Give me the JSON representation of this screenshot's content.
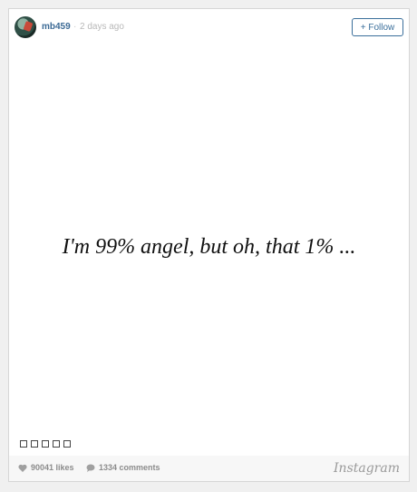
{
  "post": {
    "username": "mb459",
    "separator": "·",
    "timestamp": "2 days ago",
    "follow_label": "+ Follow",
    "quote": "I'm 99% angel, but oh, that 1% ...",
    "likes_label": "90041 likes",
    "comments_label": "1334 comments",
    "brand": "Instagram"
  },
  "colors": {
    "username": "#3c6a95",
    "follow_border": "#3b6f9b",
    "footer_bg": "#f7f7f7"
  },
  "icons": [
    "heart-icon",
    "comment-icon"
  ]
}
